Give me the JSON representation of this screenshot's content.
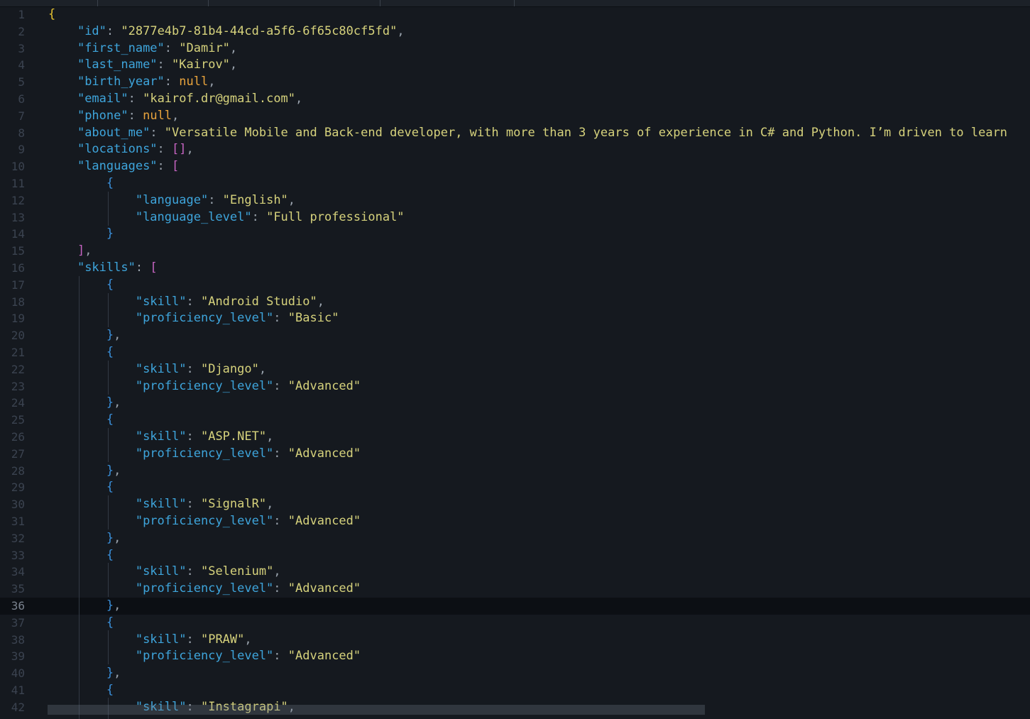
{
  "editor": {
    "current_line": 36,
    "lines": [
      {
        "n": "1",
        "t": [
          [
            "br1",
            "{"
          ]
        ]
      },
      {
        "n": "2",
        "t": [
          [
            "p",
            "    "
          ],
          [
            "k",
            "\"id\""
          ],
          [
            "p",
            ": "
          ],
          [
            "s",
            "\"2877e4b7-81b4-44cd-a5f6-6f65c80cf5fd\""
          ],
          [
            "p",
            ","
          ]
        ]
      },
      {
        "n": "3",
        "t": [
          [
            "p",
            "    "
          ],
          [
            "k",
            "\"first_name\""
          ],
          [
            "p",
            ": "
          ],
          [
            "s",
            "\"Damir\""
          ],
          [
            "p",
            ","
          ]
        ]
      },
      {
        "n": "4",
        "t": [
          [
            "p",
            "    "
          ],
          [
            "k",
            "\"last_name\""
          ],
          [
            "p",
            ": "
          ],
          [
            "s",
            "\"Kairov\""
          ],
          [
            "p",
            ","
          ]
        ]
      },
      {
        "n": "5",
        "t": [
          [
            "p",
            "    "
          ],
          [
            "k",
            "\"birth_year\""
          ],
          [
            "p",
            ": "
          ],
          [
            "n",
            "null"
          ],
          [
            "p",
            ","
          ]
        ]
      },
      {
        "n": "6",
        "t": [
          [
            "p",
            "    "
          ],
          [
            "k",
            "\"email\""
          ],
          [
            "p",
            ": "
          ],
          [
            "s",
            "\"kairof.dr@gmail.com\""
          ],
          [
            "p",
            ","
          ]
        ]
      },
      {
        "n": "7",
        "t": [
          [
            "p",
            "    "
          ],
          [
            "k",
            "\"phone\""
          ],
          [
            "p",
            ": "
          ],
          [
            "n",
            "null"
          ],
          [
            "p",
            ","
          ]
        ]
      },
      {
        "n": "8",
        "t": [
          [
            "p",
            "    "
          ],
          [
            "k",
            "\"about_me\""
          ],
          [
            "p",
            ": "
          ],
          [
            "s",
            "\"Versatile Mobile and Back-end developer, with more than 3 years of experience in C# and Python. I’m driven to learn"
          ]
        ]
      },
      {
        "n": "9",
        "t": [
          [
            "p",
            "    "
          ],
          [
            "k",
            "\"locations\""
          ],
          [
            "p",
            ": "
          ],
          [
            "br2",
            "[]"
          ],
          [
            "p",
            ","
          ]
        ]
      },
      {
        "n": "10",
        "t": [
          [
            "p",
            "    "
          ],
          [
            "k",
            "\"languages\""
          ],
          [
            "p",
            ": "
          ],
          [
            "br2",
            "["
          ]
        ]
      },
      {
        "n": "11",
        "t": [
          [
            "p",
            "        "
          ],
          [
            "br3",
            "{"
          ]
        ]
      },
      {
        "n": "12",
        "t": [
          [
            "p",
            "            "
          ],
          [
            "k",
            "\"language\""
          ],
          [
            "p",
            ": "
          ],
          [
            "s",
            "\"English\""
          ],
          [
            "p",
            ","
          ]
        ]
      },
      {
        "n": "13",
        "t": [
          [
            "p",
            "            "
          ],
          [
            "k",
            "\"language_level\""
          ],
          [
            "p",
            ": "
          ],
          [
            "s",
            "\"Full professional\""
          ]
        ]
      },
      {
        "n": "14",
        "t": [
          [
            "p",
            "        "
          ],
          [
            "br3",
            "}"
          ]
        ]
      },
      {
        "n": "15",
        "t": [
          [
            "p",
            "    "
          ],
          [
            "br2",
            "]"
          ],
          [
            "p",
            ","
          ]
        ]
      },
      {
        "n": "16",
        "t": [
          [
            "p",
            "    "
          ],
          [
            "k",
            "\"skills\""
          ],
          [
            "p",
            ": "
          ],
          [
            "br2",
            "["
          ]
        ]
      },
      {
        "n": "17",
        "t": [
          [
            "p",
            "        "
          ],
          [
            "br3",
            "{"
          ]
        ]
      },
      {
        "n": "18",
        "t": [
          [
            "p",
            "            "
          ],
          [
            "k",
            "\"skill\""
          ],
          [
            "p",
            ": "
          ],
          [
            "s",
            "\"Android Studio\""
          ],
          [
            "p",
            ","
          ]
        ]
      },
      {
        "n": "19",
        "t": [
          [
            "p",
            "            "
          ],
          [
            "k",
            "\"proficiency_level\""
          ],
          [
            "p",
            ": "
          ],
          [
            "s",
            "\"Basic\""
          ]
        ]
      },
      {
        "n": "20",
        "t": [
          [
            "p",
            "        "
          ],
          [
            "br3",
            "}"
          ],
          [
            "p",
            ","
          ]
        ]
      },
      {
        "n": "21",
        "t": [
          [
            "p",
            "        "
          ],
          [
            "br3",
            "{"
          ]
        ]
      },
      {
        "n": "22",
        "t": [
          [
            "p",
            "            "
          ],
          [
            "k",
            "\"skill\""
          ],
          [
            "p",
            ": "
          ],
          [
            "s",
            "\"Django\""
          ],
          [
            "p",
            ","
          ]
        ]
      },
      {
        "n": "23",
        "t": [
          [
            "p",
            "            "
          ],
          [
            "k",
            "\"proficiency_level\""
          ],
          [
            "p",
            ": "
          ],
          [
            "s",
            "\"Advanced\""
          ]
        ]
      },
      {
        "n": "24",
        "t": [
          [
            "p",
            "        "
          ],
          [
            "br3",
            "}"
          ],
          [
            "p",
            ","
          ]
        ]
      },
      {
        "n": "25",
        "t": [
          [
            "p",
            "        "
          ],
          [
            "br3",
            "{"
          ]
        ]
      },
      {
        "n": "26",
        "t": [
          [
            "p",
            "            "
          ],
          [
            "k",
            "\"skill\""
          ],
          [
            "p",
            ": "
          ],
          [
            "s",
            "\"ASP.NET\""
          ],
          [
            "p",
            ","
          ]
        ]
      },
      {
        "n": "27",
        "t": [
          [
            "p",
            "            "
          ],
          [
            "k",
            "\"proficiency_level\""
          ],
          [
            "p",
            ": "
          ],
          [
            "s",
            "\"Advanced\""
          ]
        ]
      },
      {
        "n": "28",
        "t": [
          [
            "p",
            "        "
          ],
          [
            "br3",
            "}"
          ],
          [
            "p",
            ","
          ]
        ]
      },
      {
        "n": "29",
        "t": [
          [
            "p",
            "        "
          ],
          [
            "br3",
            "{"
          ]
        ]
      },
      {
        "n": "30",
        "t": [
          [
            "p",
            "            "
          ],
          [
            "k",
            "\"skill\""
          ],
          [
            "p",
            ": "
          ],
          [
            "s",
            "\"SignalR\""
          ],
          [
            "p",
            ","
          ]
        ]
      },
      {
        "n": "31",
        "t": [
          [
            "p",
            "            "
          ],
          [
            "k",
            "\"proficiency_level\""
          ],
          [
            "p",
            ": "
          ],
          [
            "s",
            "\"Advanced\""
          ]
        ]
      },
      {
        "n": "32",
        "t": [
          [
            "p",
            "        "
          ],
          [
            "br3",
            "}"
          ],
          [
            "p",
            ","
          ]
        ]
      },
      {
        "n": "33",
        "t": [
          [
            "p",
            "        "
          ],
          [
            "br3",
            "{"
          ]
        ]
      },
      {
        "n": "34",
        "t": [
          [
            "p",
            "            "
          ],
          [
            "k",
            "\"skill\""
          ],
          [
            "p",
            ": "
          ],
          [
            "s",
            "\"Selenium\""
          ],
          [
            "p",
            ","
          ]
        ]
      },
      {
        "n": "35",
        "t": [
          [
            "p",
            "            "
          ],
          [
            "k",
            "\"proficiency_level\""
          ],
          [
            "p",
            ": "
          ],
          [
            "s",
            "\"Advanced\""
          ]
        ]
      },
      {
        "n": "36",
        "t": [
          [
            "p",
            "        "
          ],
          [
            "br3",
            "}"
          ],
          [
            "p",
            ","
          ]
        ]
      },
      {
        "n": "37",
        "t": [
          [
            "p",
            "        "
          ],
          [
            "br3",
            "{"
          ]
        ]
      },
      {
        "n": "38",
        "t": [
          [
            "p",
            "            "
          ],
          [
            "k",
            "\"skill\""
          ],
          [
            "p",
            ": "
          ],
          [
            "s",
            "\"PRAW\""
          ],
          [
            "p",
            ","
          ]
        ]
      },
      {
        "n": "39",
        "t": [
          [
            "p",
            "            "
          ],
          [
            "k",
            "\"proficiency_level\""
          ],
          [
            "p",
            ": "
          ],
          [
            "s",
            "\"Advanced\""
          ]
        ]
      },
      {
        "n": "40",
        "t": [
          [
            "p",
            "        "
          ],
          [
            "br3",
            "}"
          ],
          [
            "p",
            ","
          ]
        ]
      },
      {
        "n": "41",
        "t": [
          [
            "p",
            "        "
          ],
          [
            "br3",
            "{"
          ]
        ]
      },
      {
        "n": "42",
        "t": [
          [
            "p",
            "            "
          ],
          [
            "k",
            "\"skill\""
          ],
          [
            "p",
            ": "
          ],
          [
            "s",
            "\"Instagrapi\""
          ],
          [
            "p",
            ","
          ]
        ]
      }
    ]
  }
}
